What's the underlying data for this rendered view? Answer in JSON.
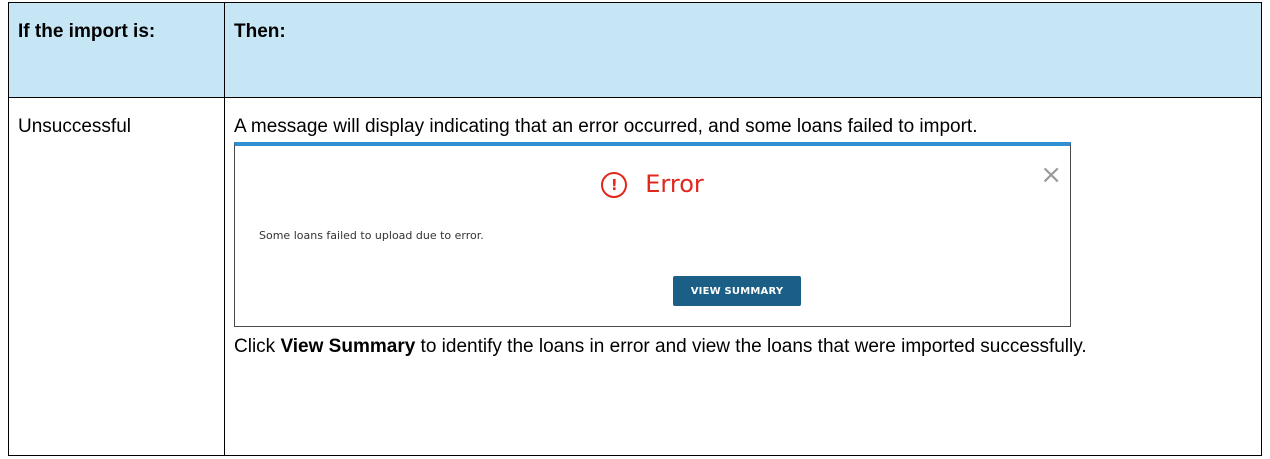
{
  "table": {
    "header": {
      "col1": "If the import is:",
      "col2": "Then:"
    },
    "row": {
      "condition": "Unsuccessful",
      "then_text_1": "A message will display indicating that an error occurred, and some loans failed to import.",
      "then_text_2_bold": "View Summary",
      "then_text_2_pre": "Click ",
      "then_text_2_post": " to identify the loans in error and view the loans that were imported successfully."
    }
  },
  "dialog": {
    "title": "Error",
    "icon": "exclamation-circle-icon",
    "icon_glyph": "!",
    "close_glyph": "×",
    "message": "Some loans failed to upload due to error.",
    "button_label": "VIEW SUMMARY",
    "accent_color": "#2f8fd0",
    "error_color": "#e0281d",
    "button_color": "#1b5e86"
  },
  "colors": {
    "header_bg": "#c6e6f6"
  }
}
